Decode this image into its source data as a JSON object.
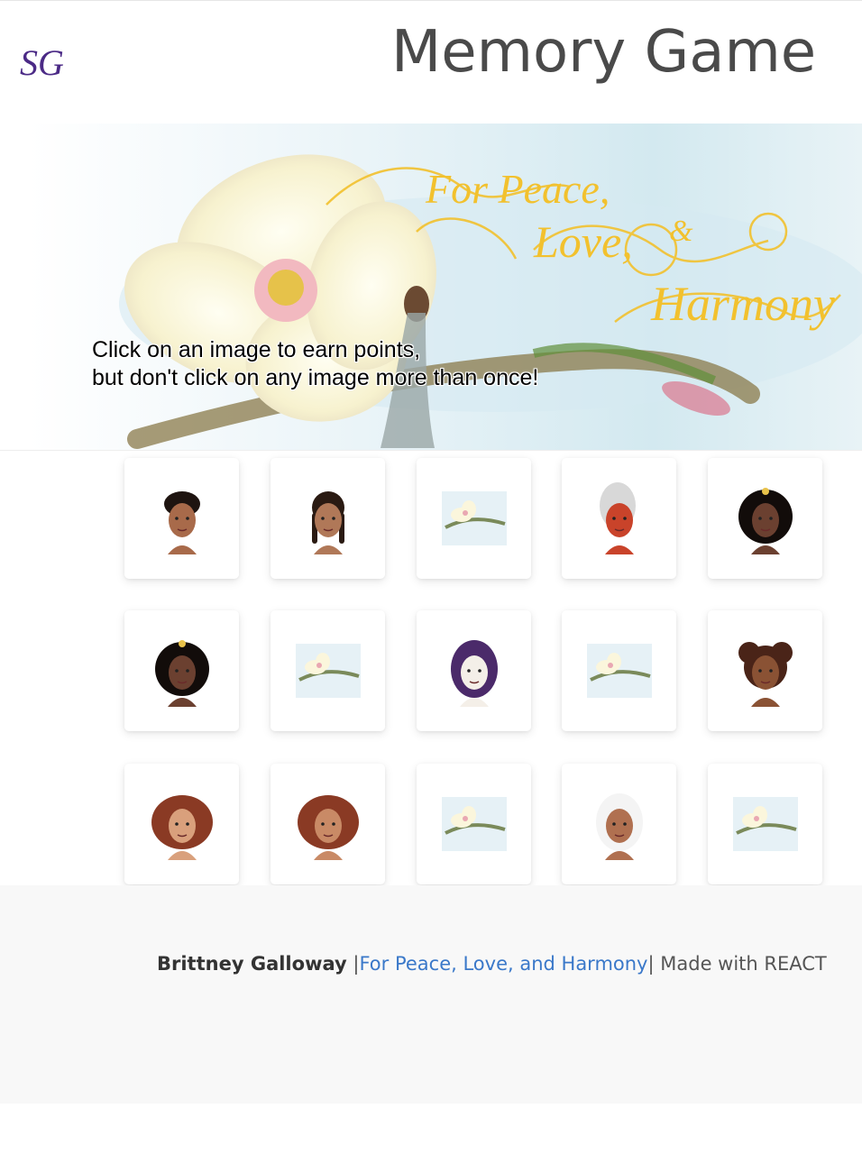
{
  "header": {
    "logo_text": "SG",
    "title": "Memory Game"
  },
  "banner": {
    "line1": "Click on an image to earn points,",
    "line2": "but don't click on any image more than once!",
    "art_text": [
      "For Peace,",
      "Love,",
      "&",
      "Harmony"
    ]
  },
  "cards": [
    {
      "name": "character-short-hair",
      "icon": "portrait-icon"
    },
    {
      "name": "character-braids",
      "icon": "portrait-icon"
    },
    {
      "name": "scene-flying",
      "icon": "landscape-icon"
    },
    {
      "name": "character-red-warrior",
      "icon": "portrait-icon"
    },
    {
      "name": "character-crowned",
      "icon": "portrait-icon"
    },
    {
      "name": "character-crowned-2",
      "icon": "portrait-icon"
    },
    {
      "name": "scene-flower",
      "icon": "landscape-icon"
    },
    {
      "name": "character-purple-hair",
      "icon": "portrait-icon"
    },
    {
      "name": "scene-flower-2",
      "icon": "landscape-icon"
    },
    {
      "name": "character-buns",
      "icon": "portrait-icon"
    },
    {
      "name": "character-auburn",
      "icon": "portrait-icon"
    },
    {
      "name": "character-auburn-2",
      "icon": "portrait-icon"
    },
    {
      "name": "scene-branch",
      "icon": "landscape-icon"
    },
    {
      "name": "character-white-hair",
      "icon": "portrait-icon"
    },
    {
      "name": "scene-branch-2",
      "icon": "landscape-icon"
    }
  ],
  "footer": {
    "author": "Brittney Galloway",
    "sep_left": " |",
    "link_text": "For Peace, Love, and Harmony",
    "sep_right": "|",
    "made_with": " Made with REACT"
  },
  "colors": {
    "title": "#4a4a4a",
    "logo": "#4b2a86",
    "link": "#3a78c9",
    "footer_bg": "#f8f8f8"
  }
}
